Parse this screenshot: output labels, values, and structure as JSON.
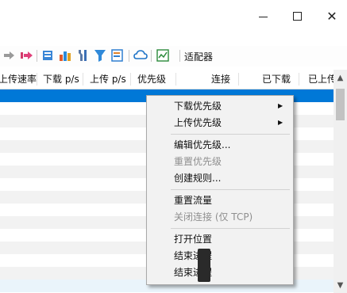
{
  "window": {
    "minimize_glyph": "",
    "maximize_glyph": "",
    "close_glyph": "✕"
  },
  "toolbar": {
    "label": "适配器",
    "icons": [
      "arrow-right-gray-icon",
      "arrow-right-pink-icon",
      "download-list-icon",
      "bar-chart-icon",
      "tools-icon",
      "filter-icon",
      "edit-rules-icon",
      "cloud-icon",
      "chart-window-icon"
    ]
  },
  "table": {
    "columns": [
      "上传速率",
      "下载 p/s",
      "上传 p/s",
      "优先级",
      "连接",
      "已下载",
      "已上传"
    ],
    "column_display": [
      "上传速率",
      "下载 p/s",
      "上传 p/s",
      "优先级",
      "连接",
      "已下载",
      "已上传"
    ]
  },
  "context_menu": {
    "items": [
      {
        "label": "下载优先级",
        "submenu": true,
        "enabled": true
      },
      {
        "label": "上传优先级",
        "submenu": true,
        "enabled": true
      },
      {
        "label": "编辑优先级...",
        "submenu": false,
        "enabled": true
      },
      {
        "label": "重置优先级",
        "submenu": false,
        "enabled": false
      },
      {
        "label": "创建规则...",
        "submenu": false,
        "enabled": true
      },
      {
        "label": "重置流量",
        "submenu": false,
        "enabled": true
      },
      {
        "label": "关闭连接（仅 TCP）",
        "submenu": false,
        "enabled": false
      },
      {
        "label": "打开位置",
        "submenu": false,
        "enabled": true
      },
      {
        "label": "结束进程",
        "submenu": false,
        "enabled": true
      },
      {
        "label": "结束进程树",
        "submenu": false,
        "enabled": true
      }
    ],
    "visible_labels": [
      "下载优先级",
      "上传优先级",
      "编辑优先级...",
      "重置优先级",
      "创建规则...",
      "重置流量",
      "关闭连接 (仅 TCP)",
      "打开位置",
      "结束进程",
      "结束进程"
    ]
  },
  "colors": {
    "selection": "#0078d7",
    "menu_bg": "#f2f2f2",
    "disabled_text": "#8f8f8f"
  }
}
